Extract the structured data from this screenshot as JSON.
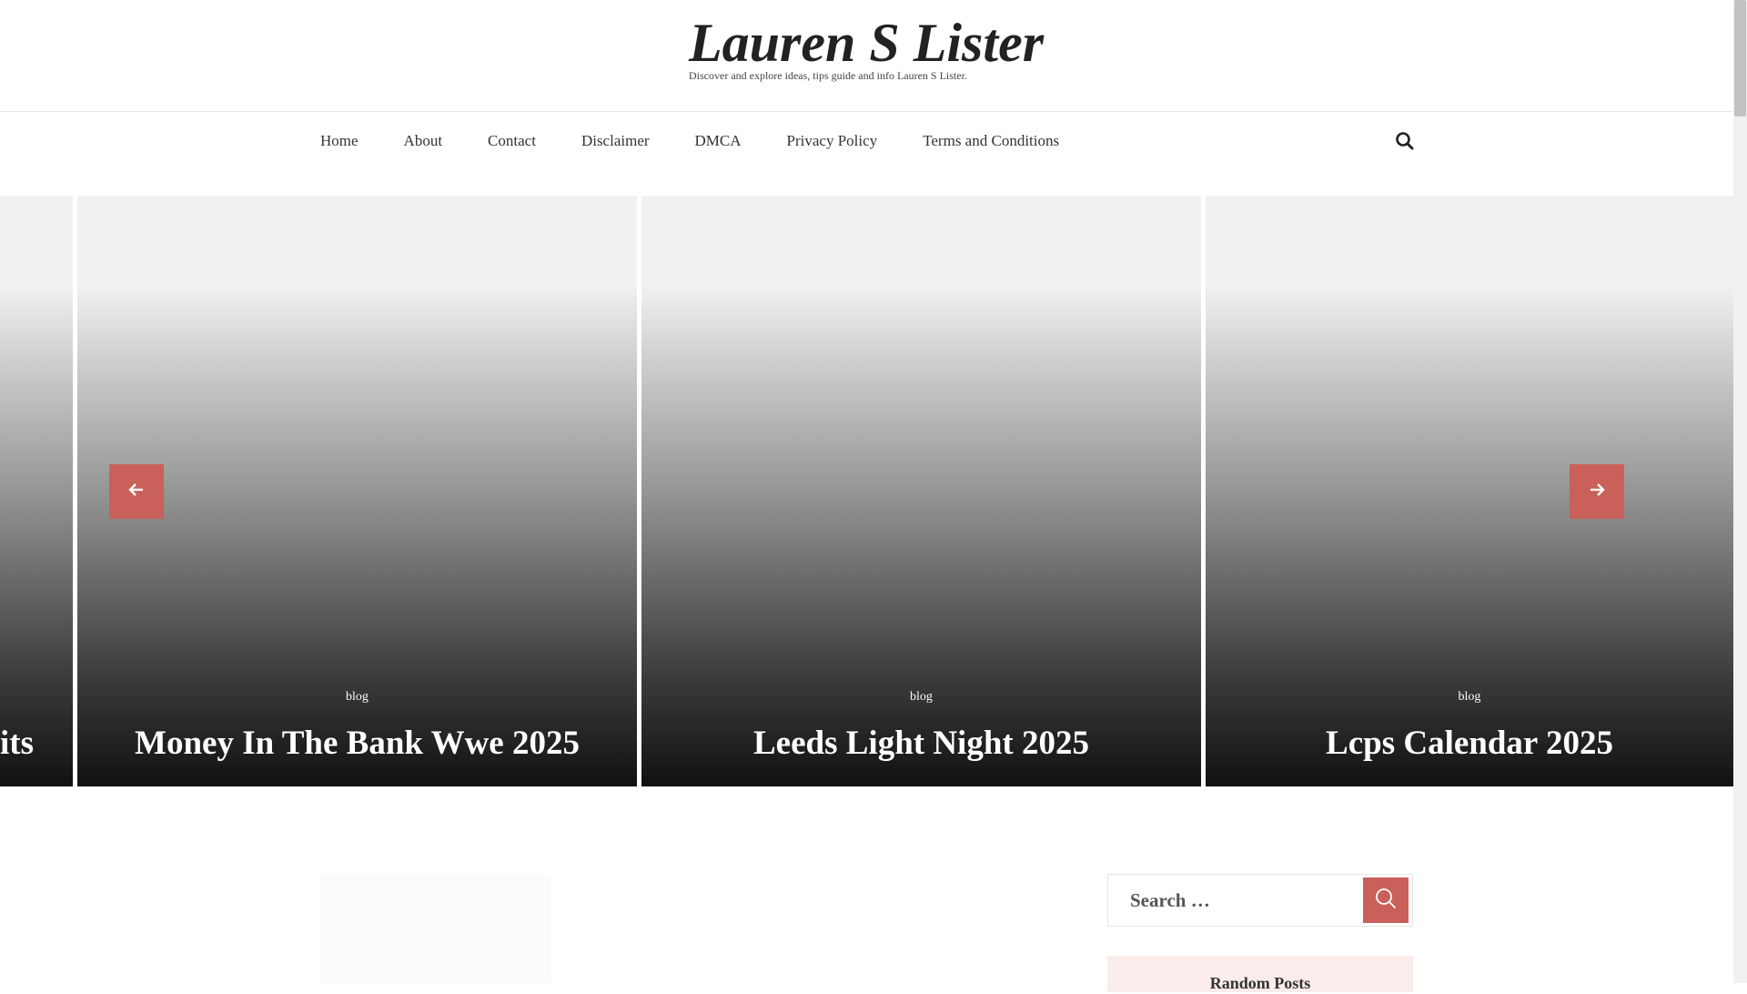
{
  "site": {
    "title": "Lauren S Lister",
    "tagline": "Discover and explore ideas, tips guide and info Lauren S Lister."
  },
  "nav": {
    "items": [
      "Home",
      "About",
      "Contact",
      "Disclaimer",
      "DMCA",
      "Privacy Policy",
      "Terms and Conditions"
    ],
    "search_icon": "search-icon"
  },
  "slider": {
    "partial_title": "its",
    "slides": [
      {
        "category": "blog",
        "title": "Money In The Bank Wwe 2025"
      },
      {
        "category": "blog",
        "title": "Leeds Light Night 2025"
      },
      {
        "category": "blog",
        "title": "Lcps Calendar 2025"
      }
    ],
    "prev_icon": "arrow-left-icon",
    "next_icon": "arrow-right-icon",
    "arrow_color": "#c9605a"
  },
  "sidebar": {
    "search": {
      "placeholder": "Search …"
    },
    "widget_title": "Random Posts"
  },
  "colors": {
    "accent": "#c9605a",
    "widget_bg": "#f9ecea"
  }
}
